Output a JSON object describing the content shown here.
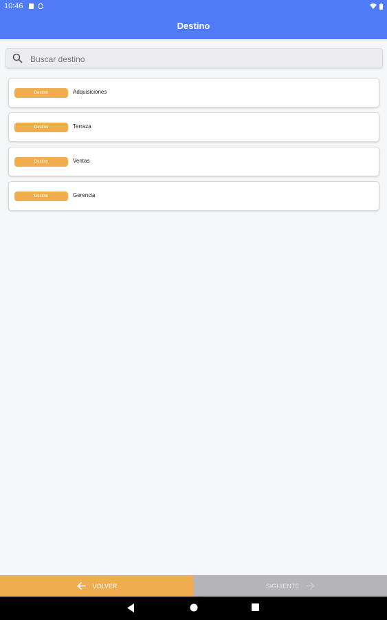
{
  "status_bar": {
    "time": "10:46"
  },
  "app_bar": {
    "title": "Destino"
  },
  "search": {
    "placeholder": "Buscar destino",
    "value": ""
  },
  "items": [
    {
      "badge": "Destino",
      "label": "Adquisiciones"
    },
    {
      "badge": "Destino",
      "label": "Terraza"
    },
    {
      "badge": "Destino",
      "label": "Ventas"
    },
    {
      "badge": "Destino",
      "label": "Gerencia"
    }
  ],
  "footer": {
    "back_label": "VOLVER",
    "next_label": "SIGUIENTE"
  },
  "colors": {
    "primary": "#4f7af8",
    "accent": "#f0ad4e",
    "disabled": "#b5b5b7"
  }
}
